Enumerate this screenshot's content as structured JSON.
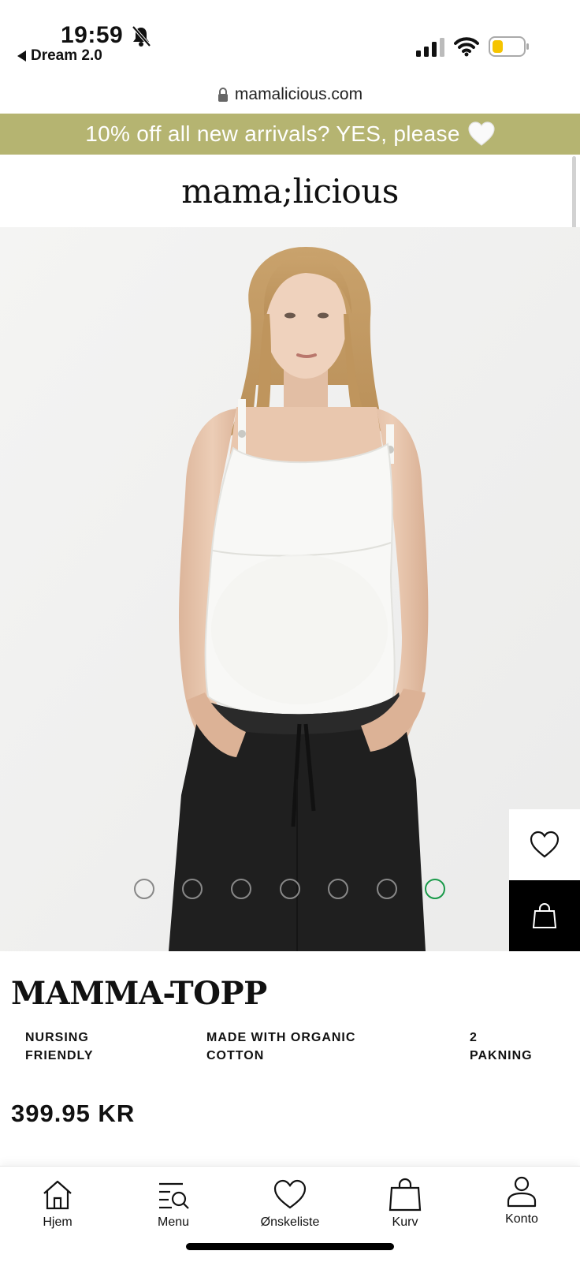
{
  "status_bar": {
    "time": "19:59",
    "back_app": "Dream 2.0"
  },
  "browser": {
    "url": "mamalicious.com"
  },
  "promo": {
    "text": "10% off all new arrivals? YES, please",
    "bg_color": "#b5b471",
    "icon": "white-heart-emoji"
  },
  "header": {
    "logo_text": "mama;licious"
  },
  "gallery": {
    "image_count": 7,
    "active_index": 6,
    "active_color": "#1a9a4a"
  },
  "product": {
    "title": "MAMMA-TOPP",
    "features": [
      {
        "line1": "NURSING",
        "line2": "FRIENDLY"
      },
      {
        "line1": "MADE WITH ORGANIC",
        "line2": "COTTON"
      },
      {
        "line1": "2",
        "line2": "PAKNING"
      }
    ],
    "price": "399.95 KR"
  },
  "bottom_nav": {
    "items": [
      {
        "label": "Hjem",
        "icon": "home-icon"
      },
      {
        "label": "Menu",
        "icon": "menu-search-icon"
      },
      {
        "label": "Ønskeliste",
        "icon": "heart-icon"
      },
      {
        "label": "Kurv",
        "icon": "bag-icon"
      },
      {
        "label": "Konto",
        "icon": "user-icon"
      }
    ]
  }
}
